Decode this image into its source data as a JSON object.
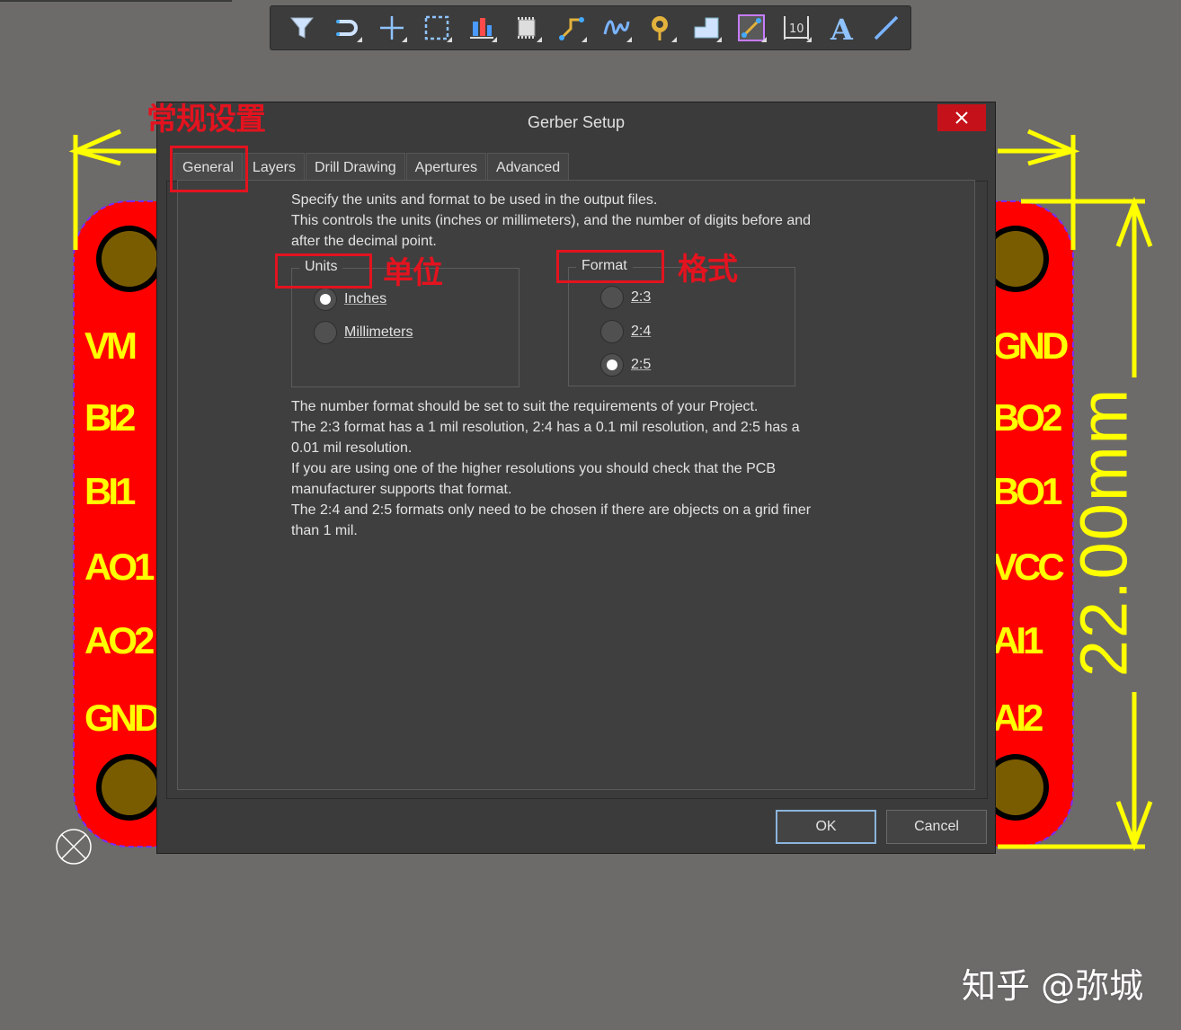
{
  "toolbar": {
    "icons": [
      "filter-icon",
      "route-icon",
      "crosshair-icon",
      "select-rect-icon",
      "align-icon",
      "component-icon",
      "interactive-route-icon",
      "diff-pair-icon",
      "via-icon",
      "fill-icon",
      "track-icon",
      "dimension-icon",
      "text-icon",
      "line-icon"
    ]
  },
  "pcb": {
    "left_labels": [
      "VM",
      "BI2",
      "BI1",
      "AO1",
      "AO2",
      "GND"
    ],
    "right_labels": [
      "GND",
      "BO2",
      "BO1",
      "VCC",
      "AI1",
      "AI2"
    ],
    "dimension": "22.00mm"
  },
  "dialog": {
    "title": "Gerber Setup",
    "tabs": [
      "General",
      "Layers",
      "Drill Drawing",
      "Apertures",
      "Advanced"
    ],
    "intro": [
      "Specify the units and format to be used in the output files.",
      "This controls the units (inches or millimeters), and the number of digits before and",
      "after the decimal point."
    ],
    "units": {
      "legend": "Units",
      "options": [
        "Inches",
        "Millimeters"
      ],
      "selected": "Inches"
    },
    "format": {
      "legend": "Format",
      "options": [
        "2:3",
        "2:4",
        "2:5"
      ],
      "selected": "2:5"
    },
    "notes": [
      "The number format should be set to suit the requirements of your Project.",
      "The 2:3 format has a 1 mil resolution, 2:4 has a 0.1 mil resolution, and 2:5 has a",
      "0.01 mil resolution.",
      "If you are using one of the higher resolutions you should check that the PCB",
      "manufacturer supports that format.",
      "The 2:4 and 2:5 formats only need to be chosen if there are objects on a grid finer",
      "than 1 mil."
    ],
    "ok_label": "OK",
    "cancel_label": "Cancel"
  },
  "annotations": {
    "general": "常规设置",
    "units": "单位",
    "format": "格式"
  },
  "watermark": "知乎 @弥城",
  "colors": {
    "background": "#6d6b69",
    "board": "#ff0000",
    "silkscreen": "#ffff00",
    "annotation": "#e3131f",
    "close_button": "#c4111a"
  }
}
